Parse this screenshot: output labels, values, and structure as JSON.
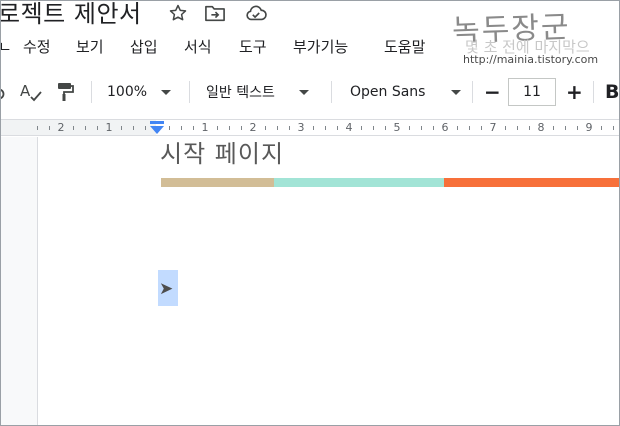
{
  "title_bar": {
    "doc_title": "로젝트 제안서",
    "star_icon": "star-icon",
    "move_icon": "move-to-folder-icon",
    "cloud_icon": "cloud-status-icon"
  },
  "watermark": {
    "main": "녹두장군",
    "url": "http://mainia.tistory.com"
  },
  "menu": {
    "items": [
      "ㄴ",
      "수정",
      "보기",
      "삽입",
      "서식",
      "도구",
      "부가기능",
      "도움말",
      "몇 초 전에 마지막으"
    ]
  },
  "toolbar": {
    "zoom": "100%",
    "style": "일반 텍스트",
    "font": "Open Sans",
    "font_size": "11",
    "minus": "−",
    "plus": "+",
    "bold": "B",
    "icons": [
      "partial-icon",
      "spellcheck-icon",
      "paint-format-icon"
    ]
  },
  "ruler": {
    "labels": [
      "2",
      "1",
      "1",
      "2",
      "3",
      "4",
      "5",
      "6",
      "7",
      "8",
      "9"
    ]
  },
  "document": {
    "heading": "시작 페이지",
    "arrow": "➤"
  },
  "colors": {
    "bar_1": "#d2bd96",
    "bar_2": "#a2e4d6",
    "bar_3": "#f7703a",
    "selection": "#c2dbff",
    "ruler_marker": "#4285f4"
  }
}
